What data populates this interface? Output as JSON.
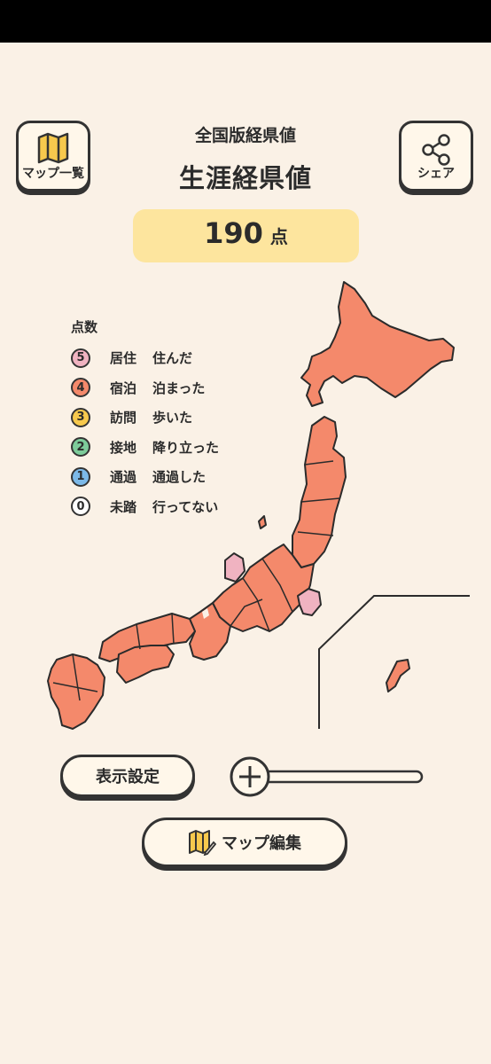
{
  "header": {
    "title": "全国版経県値",
    "subtitle": "生涯経県値",
    "map_list_label": "マップ一覧",
    "share_label": "シェア"
  },
  "score": {
    "value": "190",
    "unit": "点"
  },
  "legend": {
    "heading": "点数",
    "items": [
      {
        "num": "5",
        "name": "居住",
        "desc": "住んだ",
        "color": "#f0b3c1"
      },
      {
        "num": "4",
        "name": "宿泊",
        "desc": "泊まった",
        "color": "#f4896b"
      },
      {
        "num": "3",
        "name": "訪問",
        "desc": "歩いた",
        "color": "#f7c94d"
      },
      {
        "num": "2",
        "name": "接地",
        "desc": "降り立った",
        "color": "#7dcc9a"
      },
      {
        "num": "1",
        "name": "通過",
        "desc": "通過した",
        "color": "#7cb9e8"
      },
      {
        "num": "0",
        "name": "未踏",
        "desc": "行ってない",
        "color": "#ffffff"
      }
    ]
  },
  "map_colors": {
    "stayed": "#f4896b",
    "lived": "#f0b3c1",
    "stroke": "#2b2b2b"
  },
  "controls": {
    "display_settings_label": "表示設定",
    "map_edit_label": "マップ編集",
    "zoom_level": 0
  }
}
